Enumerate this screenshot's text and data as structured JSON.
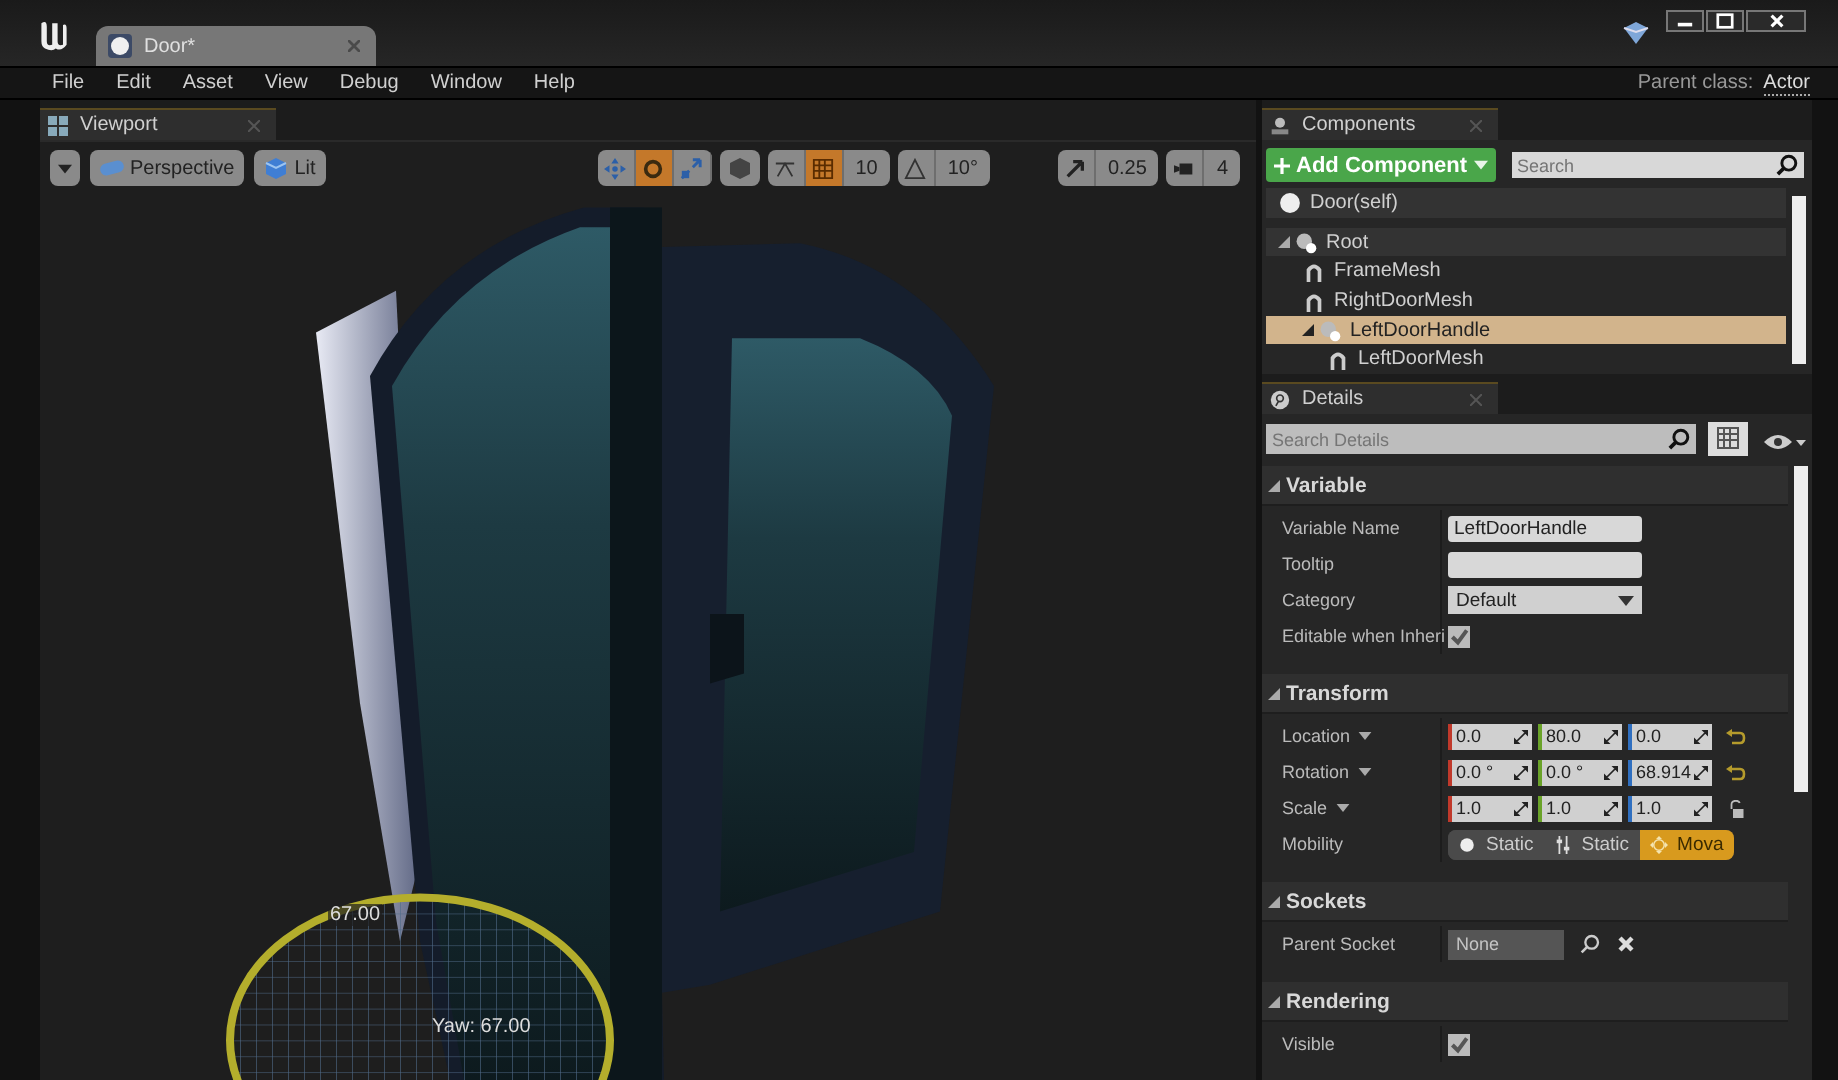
{
  "document_tab": {
    "title": "Door*"
  },
  "menu": [
    "File",
    "Edit",
    "Asset",
    "View",
    "Debug",
    "Window",
    "Help"
  ],
  "parent_class": {
    "label": "Parent class:",
    "value": "Actor"
  },
  "viewport": {
    "tab": "Viewport",
    "toolbar": {
      "view_mode": "Perspective",
      "lighting": "Lit",
      "transform_tools": [
        {
          "kind": "translate",
          "selected": false
        },
        {
          "kind": "rotate",
          "selected": true
        },
        {
          "kind": "scale",
          "selected": false
        }
      ],
      "grid_snap": {
        "on": true,
        "value": "10"
      },
      "rotation_snap": {
        "on": false,
        "value": "10°"
      },
      "scale_snap": {
        "on": false,
        "value": "0.25"
      },
      "camera_speed": "4"
    },
    "gizmo": {
      "angle": "67.00",
      "readout": "Yaw: 67.00"
    }
  },
  "components": {
    "tab": "Components",
    "add_button": "Add Component",
    "search": {
      "placeholder": "Search"
    },
    "tree": [
      {
        "label": "Door(self)",
        "kind": "actor",
        "selected": false
      },
      {
        "label": "Root",
        "kind": "scene",
        "selected": false,
        "expanded": true,
        "children": [
          {
            "label": "FrameMesh",
            "kind": "mesh",
            "selected": false
          },
          {
            "label": "RightDoorMesh",
            "kind": "mesh",
            "selected": false
          },
          {
            "label": "LeftDoorHandle",
            "kind": "scene",
            "selected": true,
            "expanded": true,
            "children": [
              {
                "label": "LeftDoorMesh",
                "kind": "mesh",
                "selected": false
              }
            ]
          }
        ]
      }
    ]
  },
  "details": {
    "tab": "Details",
    "search": {
      "placeholder": "Search Details"
    },
    "sections": [
      {
        "title": "Variable",
        "expanded": true,
        "rows": [
          {
            "kind": "text",
            "label": "Variable Name",
            "value": "LeftDoorHandle"
          },
          {
            "kind": "text",
            "label": "Tooltip"
          },
          {
            "kind": "dropdown",
            "label": "Category",
            "value": "Default"
          },
          {
            "kind": "checkbox",
            "label": "Editable when Inheri",
            "checked": true
          }
        ]
      },
      {
        "title": "Transform",
        "expanded": true,
        "rows": [
          {
            "kind": "vector",
            "label": "Location",
            "values": [
              "0.0",
              "80.0",
              "0.0"
            ],
            "reset": true
          },
          {
            "kind": "vector",
            "label": "Rotation",
            "values": [
              "0.0 °",
              "0.0 °",
              "68.914"
            ],
            "reset": true
          },
          {
            "kind": "vector",
            "label": "Scale",
            "values": [
              "1.0",
              "1.0",
              "1.0"
            ],
            "ratio_locked": false
          },
          {
            "kind": "segmented",
            "label": "Mobility",
            "options": [
              {
                "label": "Static",
                "selected": false
              },
              {
                "label": "Static",
                "selected": false
              },
              {
                "label": "Mova",
                "selected": true
              }
            ]
          }
        ]
      },
      {
        "title": "Sockets",
        "expanded": true,
        "rows": [
          {
            "kind": "socket",
            "label": "Parent Socket",
            "value": "None"
          }
        ]
      },
      {
        "title": "Rendering",
        "expanded": true,
        "rows": [
          {
            "kind": "checkbox",
            "label": "Visible",
            "checked": true
          }
        ]
      }
    ]
  }
}
